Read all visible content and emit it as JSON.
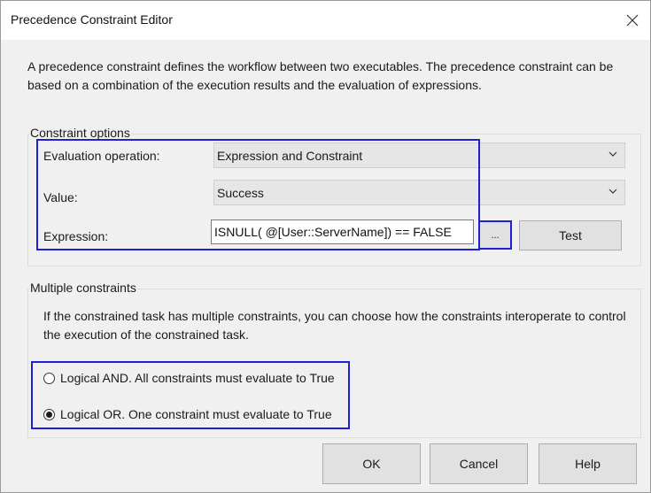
{
  "window": {
    "title": "Precedence Constraint Editor"
  },
  "description": "A precedence constraint defines the workflow between two executables. The precedence constraint can be based on a combination of the execution results and the evaluation of expressions.",
  "constraint_options": {
    "group_label": "Constraint options",
    "evaluation_label": "Evaluation operation:",
    "evaluation_value": "Expression and Constraint",
    "value_label": "Value:",
    "value_value": "Success",
    "expression_label": "Expression:",
    "expression_value": "ISNULL( @[User::ServerName]) == FALSE",
    "ellipsis_label": "...",
    "test_label": "Test"
  },
  "multiple_constraints": {
    "group_label": "Multiple constraints",
    "description": "If the constrained task has multiple constraints, you can choose how the constraints interoperate to control the execution of the constrained task.",
    "options": [
      {
        "label": "Logical AND. All constraints must evaluate to True",
        "selected": false
      },
      {
        "label": "Logical OR. One constraint must evaluate to True",
        "selected": true
      }
    ]
  },
  "buttons": {
    "ok": "OK",
    "cancel": "Cancel",
    "help": "Help"
  },
  "icons": {
    "close": "close-icon",
    "dropdown": "chevron-down-icon"
  },
  "colors": {
    "highlight": "#1f1fd6",
    "dialog_bg": "#f0f0f0",
    "combo_bg": "#e6e6e6"
  }
}
